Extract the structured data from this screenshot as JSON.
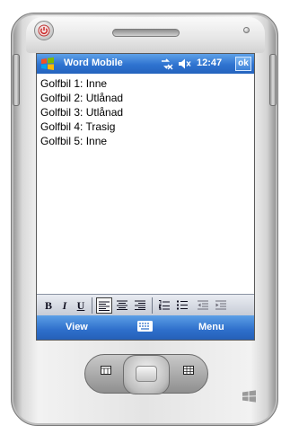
{
  "device": {
    "power_icon": "power-icon",
    "brand_logo": "windows-flag-icon"
  },
  "titlebar": {
    "start_icon": "windows-flag-icon",
    "app_title": "Word Mobile",
    "connectivity_icon": "connectivity-icon",
    "volume_icon": "speaker-muted-icon",
    "clock": "12:47",
    "ok_label": "ok"
  },
  "document": {
    "lines": [
      "Golfbil 1: Inne",
      "Golfbil 2: Utlånad",
      "Golfbil 3: Utlånad",
      "Golfbil 4: Trasig",
      "Golfbil 5: Inne"
    ]
  },
  "toolbar": {
    "bold_label": "B",
    "italic_label": "I",
    "underline_label": "U",
    "icons": [
      "align-left-icon",
      "align-center-icon",
      "align-right-icon",
      "numbered-list-icon",
      "bulleted-list-icon",
      "decrease-indent-icon",
      "increase-indent-icon"
    ],
    "active": "align-left-icon"
  },
  "softkeys": {
    "left_label": "View",
    "right_label": "Menu",
    "input_icon": "keyboard-icon"
  },
  "colors": {
    "titlebar": "#2f73d0",
    "softbar": "#2e6fcb",
    "toolbar": "#c7ccd6",
    "device_body": "#e4e4e4"
  }
}
